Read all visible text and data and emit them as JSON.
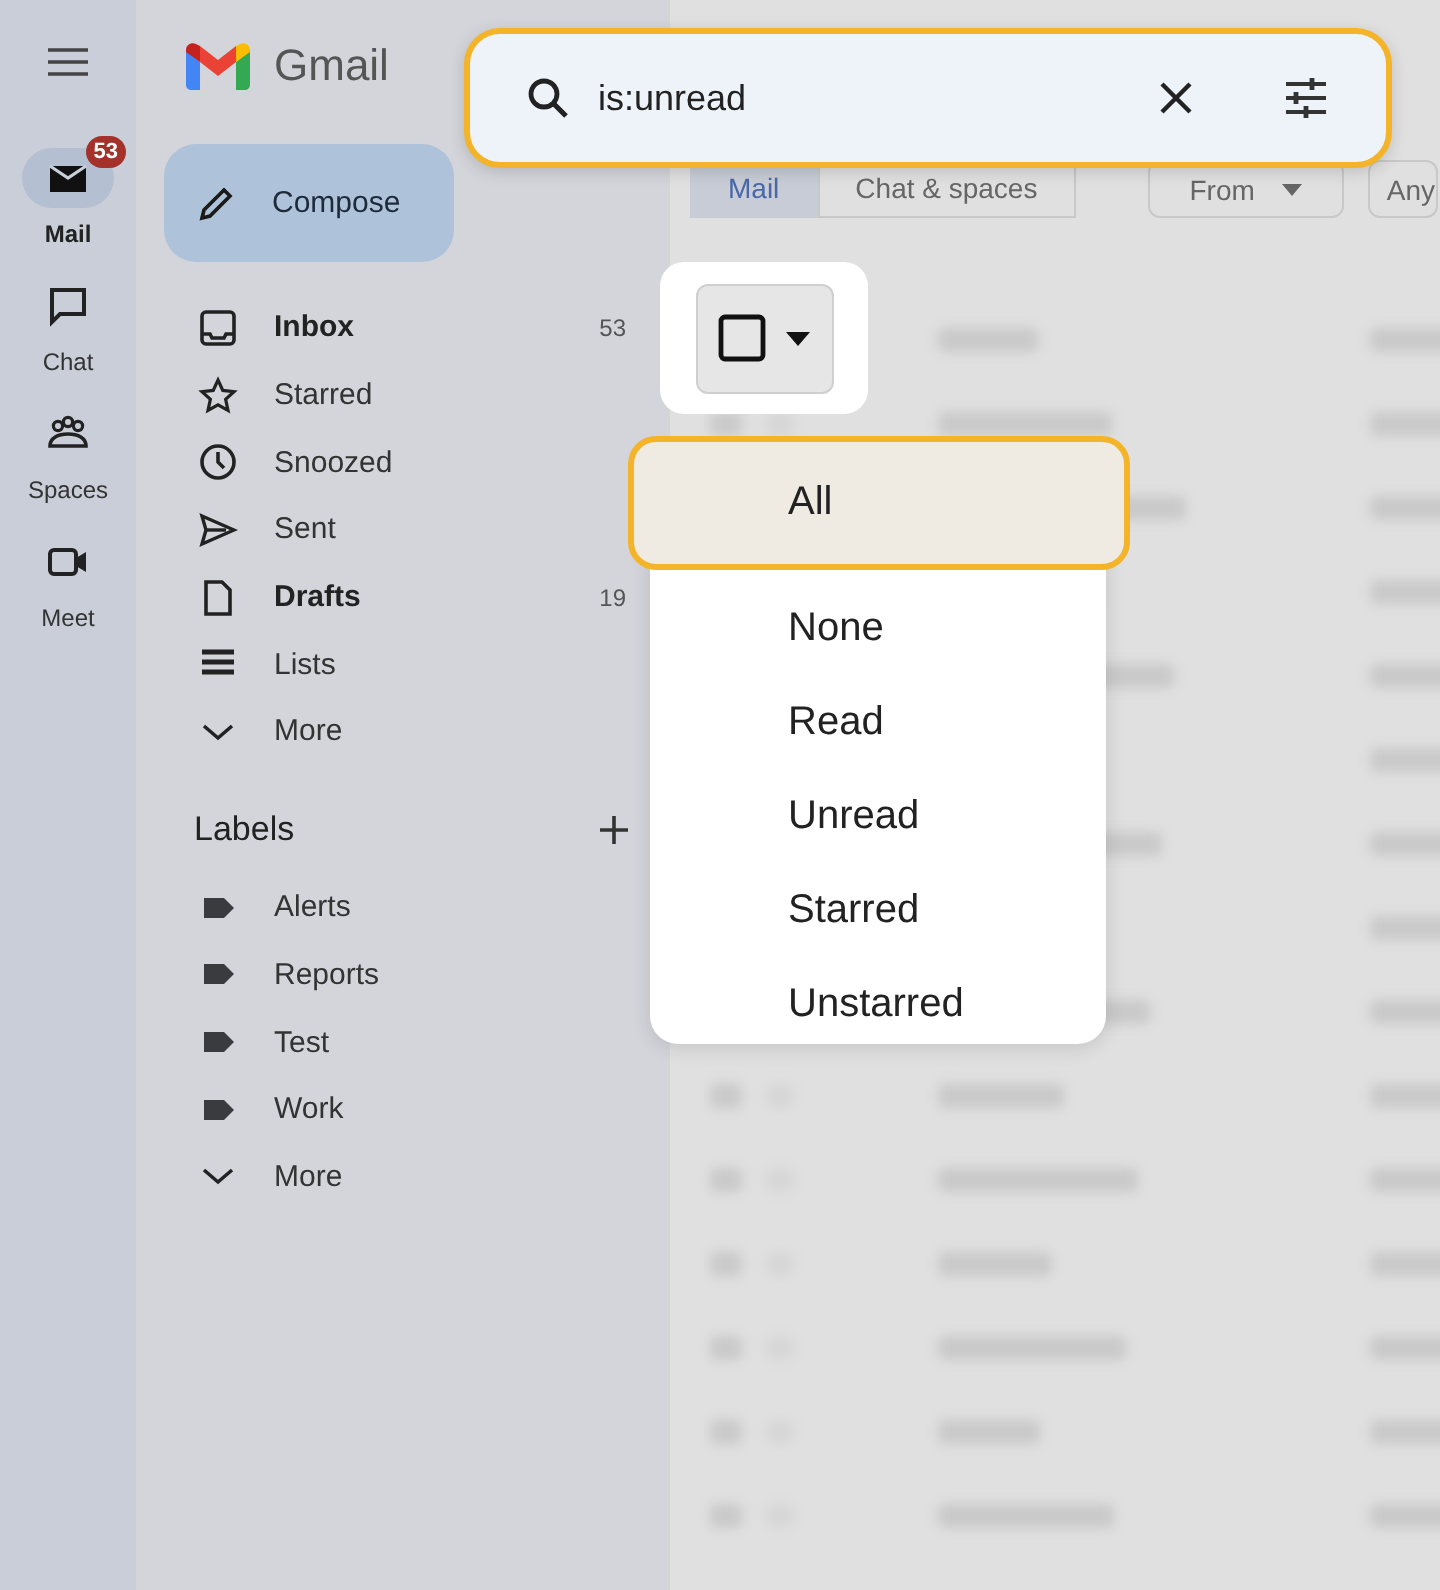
{
  "rail": {
    "items": [
      {
        "label": "Mail",
        "selected": true,
        "badge": "53"
      },
      {
        "label": "Chat",
        "selected": false
      },
      {
        "label": "Spaces",
        "selected": false
      },
      {
        "label": "Meet",
        "selected": false
      }
    ]
  },
  "sidebar": {
    "logo": "Gmail",
    "compose": "Compose",
    "folders": [
      {
        "label": "Inbox",
        "unread": true,
        "count": "53"
      },
      {
        "label": "Starred",
        "unread": false
      },
      {
        "label": "Snoozed",
        "unread": false
      },
      {
        "label": "Sent",
        "unread": false
      },
      {
        "label": "Drafts",
        "unread": true,
        "count": "19"
      },
      {
        "label": "Lists",
        "unread": false
      },
      {
        "label": "More",
        "unread": false
      }
    ],
    "labels_title": "Labels",
    "labels": [
      {
        "label": "Alerts"
      },
      {
        "label": "Reports"
      },
      {
        "label": "Test"
      },
      {
        "label": "Work"
      },
      {
        "label": "More"
      }
    ]
  },
  "search": {
    "value": "is:unread"
  },
  "tabs": [
    {
      "label": "Mail",
      "selected": true
    },
    {
      "label": "Chat & spaces",
      "selected": false
    }
  ],
  "filters": [
    {
      "label": "From"
    },
    {
      "label": "Any"
    }
  ],
  "select_menu": {
    "options": [
      {
        "label": "All",
        "selected": true
      },
      {
        "label": "None",
        "selected": false
      },
      {
        "label": "Read",
        "selected": false
      },
      {
        "label": "Unread",
        "selected": false
      },
      {
        "label": "Starred",
        "selected": false
      },
      {
        "label": "Unstarred",
        "selected": false
      }
    ]
  }
}
